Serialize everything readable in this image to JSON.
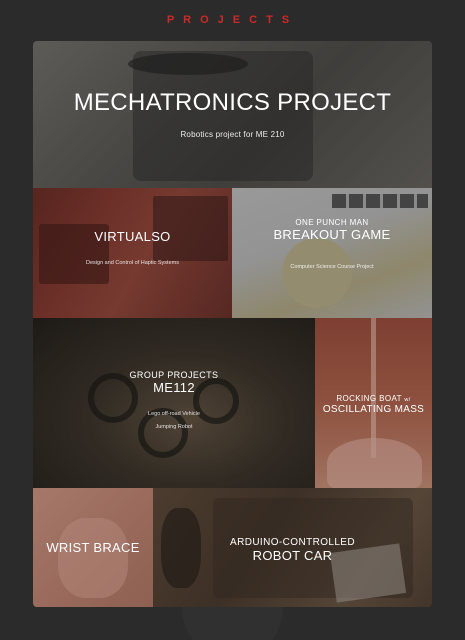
{
  "header": {
    "title": "PROJECTS"
  },
  "tiles": {
    "mechatronics": {
      "title": "MECHATRONICS PROJECT",
      "subtitle": "Robotics project for ME 210"
    },
    "virtualso": {
      "title": "VIRTUALSO",
      "subtitle": "Design and Control of Haptic Systems"
    },
    "breakout": {
      "pre": "ONE PUNCH MAN",
      "title": "BREAKOUT GAME",
      "subtitle": "Computer Science Course Project"
    },
    "me112": {
      "pre": "GROUP PROJECTS",
      "title": "ME112",
      "line1": "Lego off-road Vehicle",
      "line2": "Jumping Robot"
    },
    "rocking": {
      "pre": "ROCKING BOAT",
      "pre_suffix": "w/",
      "title": "OSCILLATING MASS"
    },
    "wrist": {
      "title": "WRIST BRACE"
    },
    "robotcar": {
      "pre": "ARDUINO-CONTROLLED",
      "title": "ROBOT CAR"
    }
  }
}
